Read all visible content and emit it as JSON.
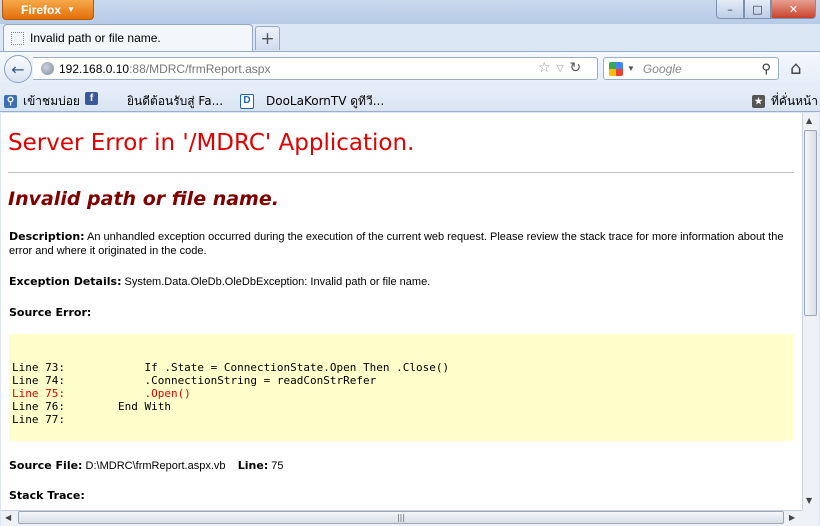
{
  "window": {
    "app_button": "Firefox",
    "min_symbol": "–",
    "max_symbol": "□",
    "close_symbol": "✕"
  },
  "tab": {
    "title": "Invalid path or file name.",
    "new_tab_symbol": "+"
  },
  "nav": {
    "back_symbol": "←",
    "url_host": "192.168.0.10",
    "url_path": ":88/MDRC/frmReport.aspx",
    "search_placeholder": "Google",
    "home_symbol": "⌂"
  },
  "bookmarks": {
    "items": [
      {
        "label": "เข้าชมบ่อย",
        "icon": "search-bookmark-icon"
      },
      {
        "label": "ยินดีต้อนรับสู่ Fa...",
        "icon": "facebook-icon"
      },
      {
        "label": "DooLaKornTV ดูทีวี...",
        "icon": "d-logo-icon"
      }
    ],
    "right_label": "ที่คั่นหน้า",
    "facebook_glyph": "f",
    "d_glyph": "D"
  },
  "page": {
    "title": "Server Error in '/MDRC' Application.",
    "subtitle": "Invalid path or file name.",
    "description_label": "Description:",
    "description_text": "An unhandled exception occurred during the execution of the current web request. Please review the stack trace for more information about the error and where it originated in the code.",
    "exception_label": "Exception Details:",
    "exception_text": "System.Data.OleDb.OleDbException: Invalid path or file name.",
    "source_error_label": "Source Error:",
    "code_lines": [
      {
        "text": "Line 73:            If .State = ConnectionState.Open Then .Close()",
        "error": false
      },
      {
        "text": "Line 74:            .ConnectionString = readConStrRefer",
        "error": false
      },
      {
        "text": "Line 75:            .Open()",
        "error": true
      },
      {
        "text": "Line 76:        End With",
        "error": false
      },
      {
        "text": "Line 77:",
        "error": false
      }
    ],
    "source_file_label": "Source File:",
    "source_file_value": "D:\\MDRC\\frmReport.aspx.vb",
    "line_label": "Line:",
    "line_value": "75",
    "stack_trace_label": "Stack Trace:"
  },
  "colors": {
    "error_red": "#e00000",
    "subtitle_maroon": "#800000",
    "code_bg": "#ffffcc",
    "firefox_orange": "#e8760f"
  }
}
